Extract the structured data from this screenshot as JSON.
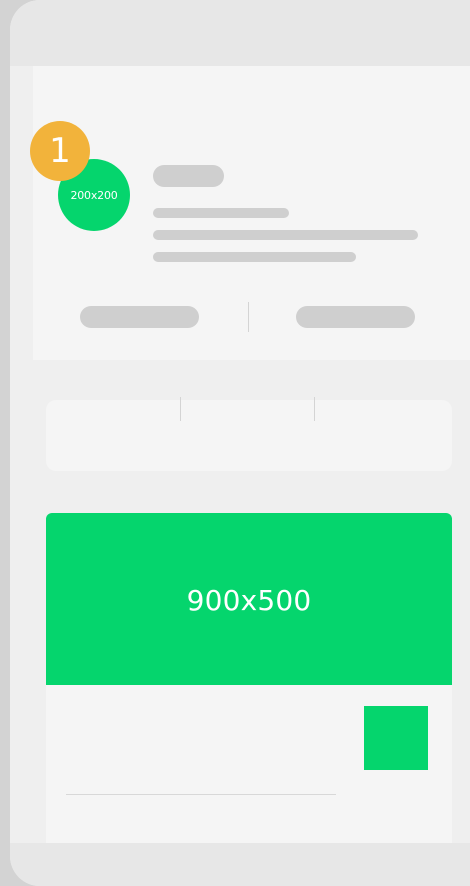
{
  "colors": {
    "accent": "#05d56d",
    "badge": "#f2b33b",
    "placeholder_gray": "#cfcfcf",
    "card_bg": "#f5f5f5",
    "screen_bg": "#efefef"
  },
  "profile": {
    "avatar_label": "200x200",
    "step_badge": "1"
  },
  "content_card": {
    "banner_label": "900x500"
  }
}
